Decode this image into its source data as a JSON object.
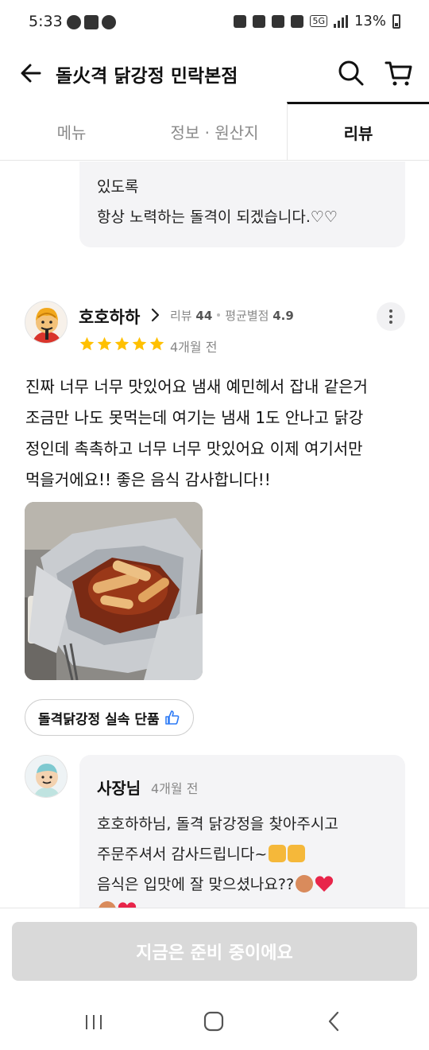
{
  "status_bar": {
    "time": "5:33",
    "battery": "13%",
    "network_badge": "5G"
  },
  "header": {
    "title": "돌火격 닭강정 민락본점",
    "back_icon": "arrow-left-icon",
    "search_icon": "search-icon",
    "cart_icon": "cart-icon"
  },
  "tabs": [
    {
      "label": "메뉴",
      "active": false
    },
    {
      "label": "정보 · 원산지",
      "active": false
    },
    {
      "label": "리뷰",
      "active": true
    }
  ],
  "previous_reply": {
    "lines": [
      "있도록",
      "항상 노력하는 돌격이 되겠습니다.♡♡"
    ]
  },
  "review": {
    "reviewer_name": "호호하하",
    "review_count_label": "리뷰",
    "review_count": "44",
    "avg_rating_label": "평균별점",
    "avg_rating": "4.9",
    "stars": 5,
    "date": "4개월 전",
    "text_lines": [
      "진짜 너무 너무 맛있어요 냄새 예민헤서 잡내 같은거",
      " 조금만 나도 못먹는데 여기는 냄새 1도 안나고 닭강",
      "정인데 촉촉하고 너무 너무 맛있어요 이제 여기서만",
      "먹을거에요!! 좋은 음식 감사합니다!!"
    ],
    "menu_tag": "돌격닭강정 실속 단품",
    "star_color": "#ffc000"
  },
  "owner_reply": {
    "name": "사장님",
    "date": "4개월 전",
    "lines": [
      "호호하하님, 돌격 닭강정을 찾아주시고",
      "주문주셔서 감사드립니다~",
      "음식은 입맛에 잘 맞으셨나요??"
    ]
  },
  "bottom_button": {
    "label": "지금은 준비 중이에요"
  }
}
